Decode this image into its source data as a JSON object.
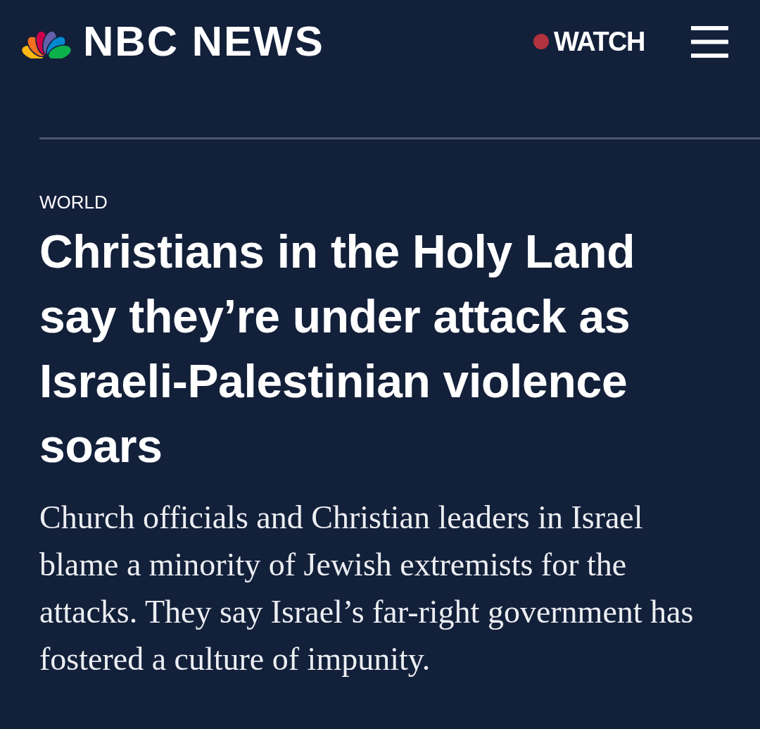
{
  "header": {
    "brand": "NBC NEWS",
    "watch": {
      "label": "WATCH"
    }
  },
  "article": {
    "section": "WORLD",
    "headline": "Christians in the Holy Land say they’re under attack as Israeli-Palestinian violence soars",
    "dek": "Church officials and Christian leaders in Israel blame a minority of Jewish extremists for the attacks. They say Israel’s far-right government has fostered a culture of impunity."
  }
}
